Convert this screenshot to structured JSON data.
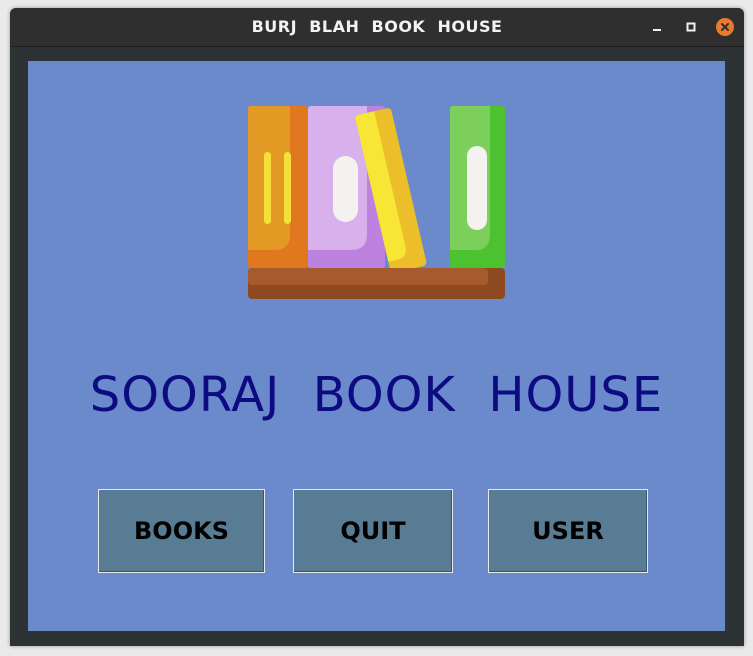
{
  "window": {
    "title": "BURJ  BLAH  BOOK  HOUSE",
    "controls": {
      "minimize_icon": "minimize-icon",
      "maximize_icon": "maximize-icon",
      "close_icon": "close-icon"
    }
  },
  "main": {
    "logo_icon": "bookshelf-icon",
    "heading": "SOORAJ  BOOK  HOUSE",
    "buttons": {
      "books": "BOOKS",
      "quit": "QUIT",
      "user": "USER"
    }
  },
  "colors": {
    "background": "#6a8acc",
    "heading": "#0d0a82",
    "button": "#577c94",
    "close_button": "#e9792e",
    "titlebar": "#2f2f2f"
  }
}
